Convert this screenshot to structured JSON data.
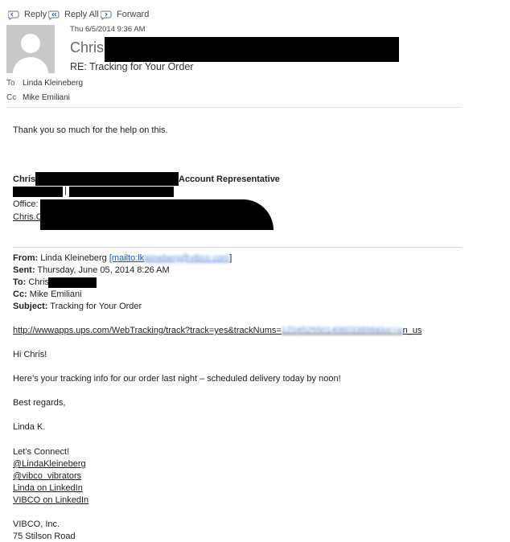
{
  "toolbar": {
    "reply": "Reply",
    "reply_all": "Reply All",
    "forward": "Forward"
  },
  "header": {
    "date": "Thu 6/5/2014 9:36 AM",
    "sender_name": "Chris",
    "subject": "RE: Tracking for Your Order",
    "to_label": "To",
    "to_value": "Linda Kleineberg",
    "cc_label": "Cc",
    "cc_value": "Mike Emiliani"
  },
  "reply": {
    "message": "Thank you so much for the help on this.",
    "sig_name": "Chris",
    "sig_title": "Account Representative",
    "office_label": "Office:",
    "email_prefix": "Chris.C"
  },
  "quoted": {
    "from_label": "From:",
    "from_value": "Linda Kleineberg",
    "mailto_open": "[mailto:lk",
    "mailto_blur": "leineberg@vibco.com",
    "mailto_close": "]",
    "sent_label": "Sent:",
    "sent_value": "Thursday, June 05, 2014 8:26 AM",
    "to_label": "To:",
    "to_value": "Chris",
    "cc_label": "Cc:",
    "cc_value": "Mike Emiliani",
    "subject_label": "Subject:",
    "subject_value": "Tracking for Your Order",
    "tracking_link_start": "http://wwwapps.ups.com/WebTracking/track?track=yes&trackNums=",
    "tracking_link_blur": "1Z04525501406033898&loc=e",
    "tracking_link_end": "n_us",
    "greeting": "Hi Chris!",
    "body": "Here’s your tracking info for our order last night – scheduled delivery today by noon!",
    "closing": "Best regards,",
    "signoff": "Linda K.",
    "connect": "Let’s Connect!",
    "links": [
      "@LindaKleineberg",
      "@vibco_vibrators",
      "Linda on LinkedIn",
      "VIBCO on LinkedIn"
    ],
    "company": "VIBCO, Inc.",
    "address": "75 Stilson Road"
  }
}
